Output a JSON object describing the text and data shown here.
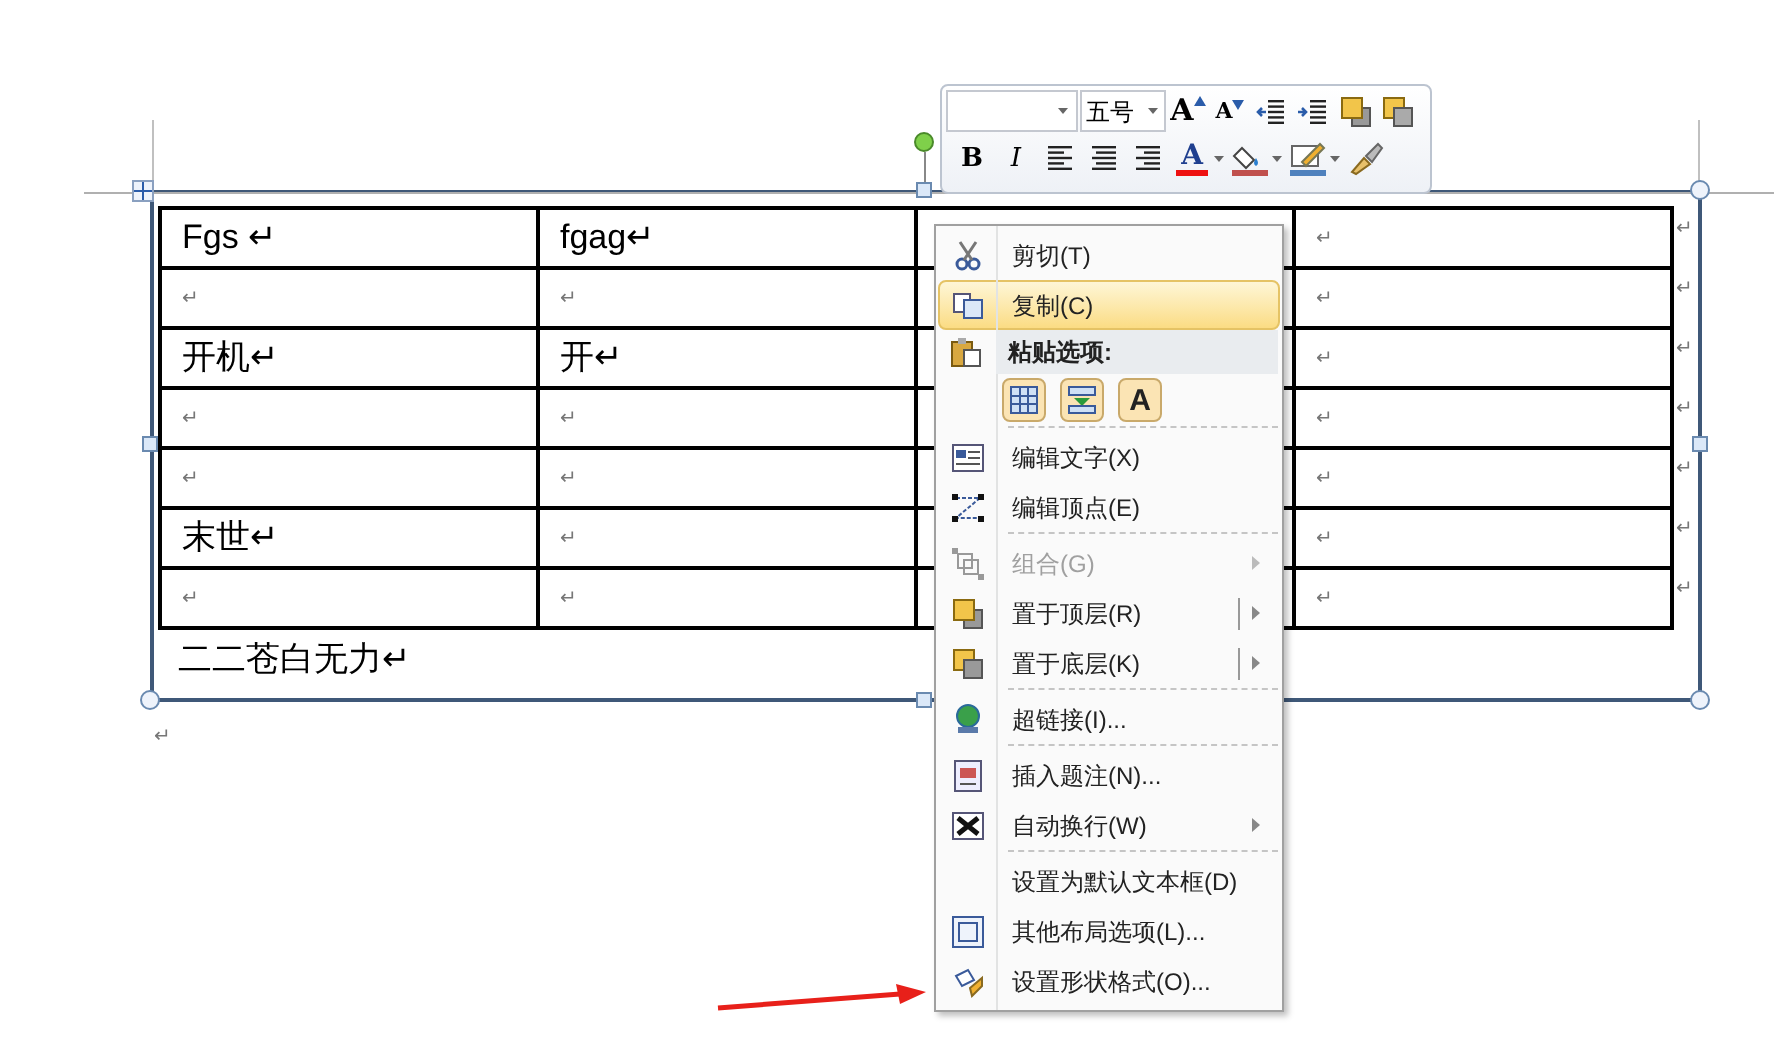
{
  "toolbar": {
    "font_size": "五号",
    "row1": [
      {
        "kind": "grow",
        "glyph": "A"
      },
      {
        "kind": "shrink",
        "glyph": "A"
      },
      {
        "kind": "outdent"
      },
      {
        "kind": "indent"
      },
      {
        "kind": "front"
      },
      {
        "kind": "back"
      }
    ],
    "row2": [
      {
        "kind": "bold",
        "glyph": "B"
      },
      {
        "kind": "italic",
        "glyph": "I"
      },
      {
        "kind": "align_left"
      },
      {
        "kind": "align_center"
      },
      {
        "kind": "align_right"
      },
      {
        "kind": "font_color",
        "glyph": "A",
        "dropdown": true
      },
      {
        "kind": "highlight",
        "dropdown": true
      },
      {
        "kind": "line_color",
        "dropdown": true
      },
      {
        "kind": "painter"
      }
    ]
  },
  "table": {
    "rows": [
      [
        "Fgs ↵",
        "fgag↵",
        "",
        "↵"
      ],
      [
        "↵",
        "↵",
        "",
        "↵"
      ],
      [
        "开机↵",
        "开↵",
        "",
        "↵"
      ],
      [
        "↵",
        "↵",
        "",
        "↵"
      ],
      [
        "↵",
        "↵",
        "",
        "↵"
      ],
      [
        "末世↵",
        "↵",
        "",
        "↵"
      ],
      [
        "↵",
        "↵",
        "",
        "↵"
      ]
    ],
    "row_end_marks": [
      "↵",
      "↵",
      "↵",
      "↵",
      "↵",
      "↵",
      "↵"
    ],
    "caption": "二二苍白无力↵"
  },
  "after_mark": "↵",
  "context_menu": [
    {
      "kind": "item",
      "label": "剪切(T)",
      "selected": false,
      "disabled": false
    },
    {
      "kind": "item",
      "label": "复制(C)",
      "selected": true,
      "disabled": false
    },
    {
      "kind": "header",
      "label": "粘贴选项:"
    },
    {
      "kind": "paste_options",
      "glyph": "A"
    },
    {
      "kind": "separator"
    },
    {
      "kind": "item",
      "label": "编辑文字(X)",
      "selected": false,
      "disabled": false
    },
    {
      "kind": "item",
      "label": "编辑顶点(E)",
      "selected": false,
      "disabled": false
    },
    {
      "kind": "separator"
    },
    {
      "kind": "item",
      "label": "组合(G)",
      "selected": false,
      "disabled": true,
      "submenu": true
    },
    {
      "kind": "item",
      "label": "置于顶层(R)",
      "selected": false,
      "disabled": false,
      "submenu": true,
      "split": true
    },
    {
      "kind": "item",
      "label": "置于底层(K)",
      "selected": false,
      "disabled": false,
      "submenu": true,
      "split": true
    },
    {
      "kind": "separator"
    },
    {
      "kind": "item",
      "label": "超链接(I)...",
      "selected": false,
      "disabled": false
    },
    {
      "kind": "separator"
    },
    {
      "kind": "item",
      "label": "插入题注(N)...",
      "selected": false,
      "disabled": false
    },
    {
      "kind": "item",
      "label": "自动换行(W)",
      "selected": false,
      "disabled": false,
      "submenu": true
    },
    {
      "kind": "separator"
    },
    {
      "kind": "item",
      "label": "设置为默认文本框(D)",
      "selected": false,
      "disabled": false
    },
    {
      "kind": "item",
      "label": "其他布局选项(L)...",
      "selected": false,
      "disabled": false
    },
    {
      "kind": "item",
      "label": "设置形状格式(O)...",
      "selected": false,
      "disabled": false
    }
  ]
}
